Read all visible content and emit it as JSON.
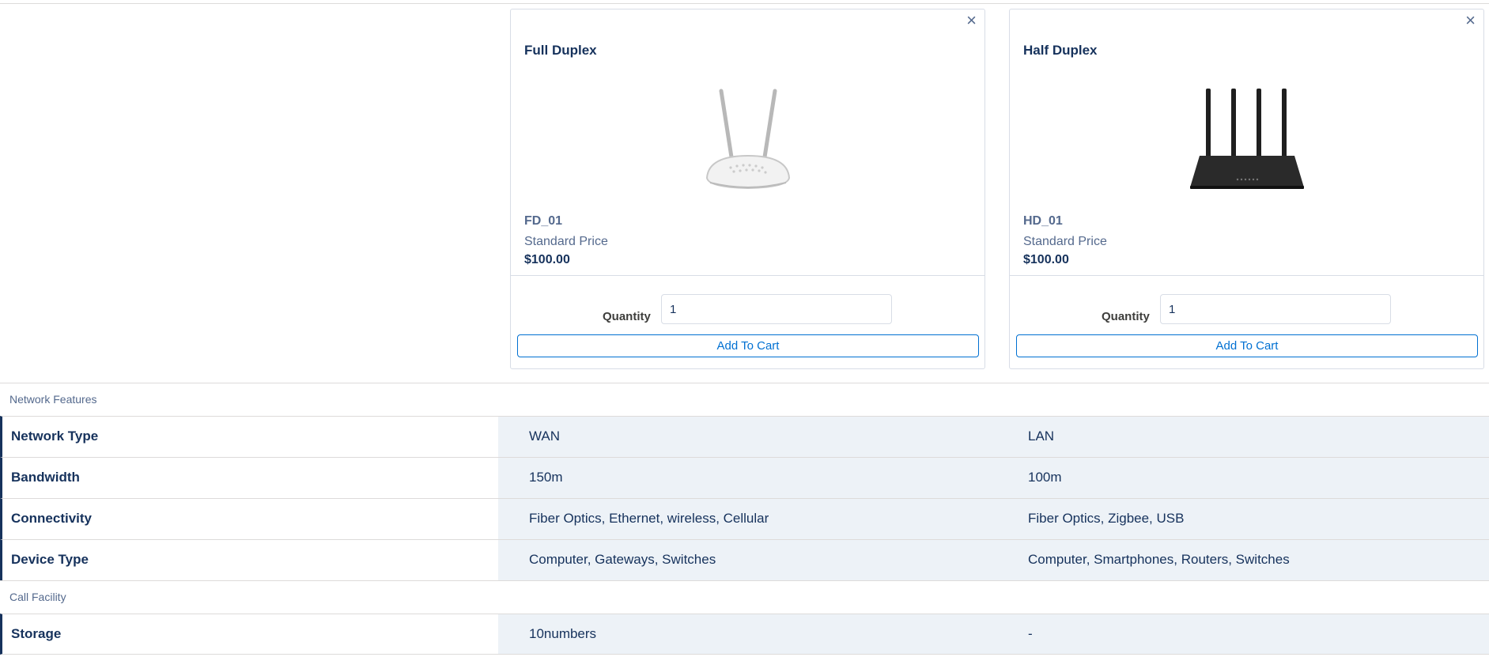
{
  "products": [
    {
      "name": "Full Duplex",
      "code": "FD_01",
      "price_label": "Standard Price",
      "price": "$100.00",
      "quantity_label": "Quantity",
      "quantity": "1",
      "add_to_cart": "Add To Cart",
      "close_icon": "×",
      "image_icon": "router-white-two-antenna-icon"
    },
    {
      "name": "Half Duplex",
      "code": "HD_01",
      "price_label": "Standard Price",
      "price": "$100.00",
      "quantity_label": "Quantity",
      "quantity": "1",
      "add_to_cart": "Add To Cart",
      "close_icon": "×",
      "image_icon": "router-black-four-antenna-icon"
    }
  ],
  "sections": [
    {
      "title": "Network Features",
      "rows": [
        {
          "label": "Network Type",
          "values": [
            "WAN",
            "LAN"
          ]
        },
        {
          "label": "Bandwidth",
          "values": [
            "150m",
            "100m"
          ]
        },
        {
          "label": "Connectivity",
          "values": [
            "Fiber Optics, Ethernet, wireless, Cellular",
            "Fiber Optics, Zigbee, USB"
          ]
        },
        {
          "label": "Device Type",
          "values": [
            "Computer, Gateways, Switches",
            "Computer, Smartphones, Routers, Switches"
          ]
        }
      ]
    },
    {
      "title": "Call Facility",
      "rows": [
        {
          "label": "Storage",
          "values": [
            "10numbers",
            "-"
          ]
        }
      ]
    }
  ]
}
